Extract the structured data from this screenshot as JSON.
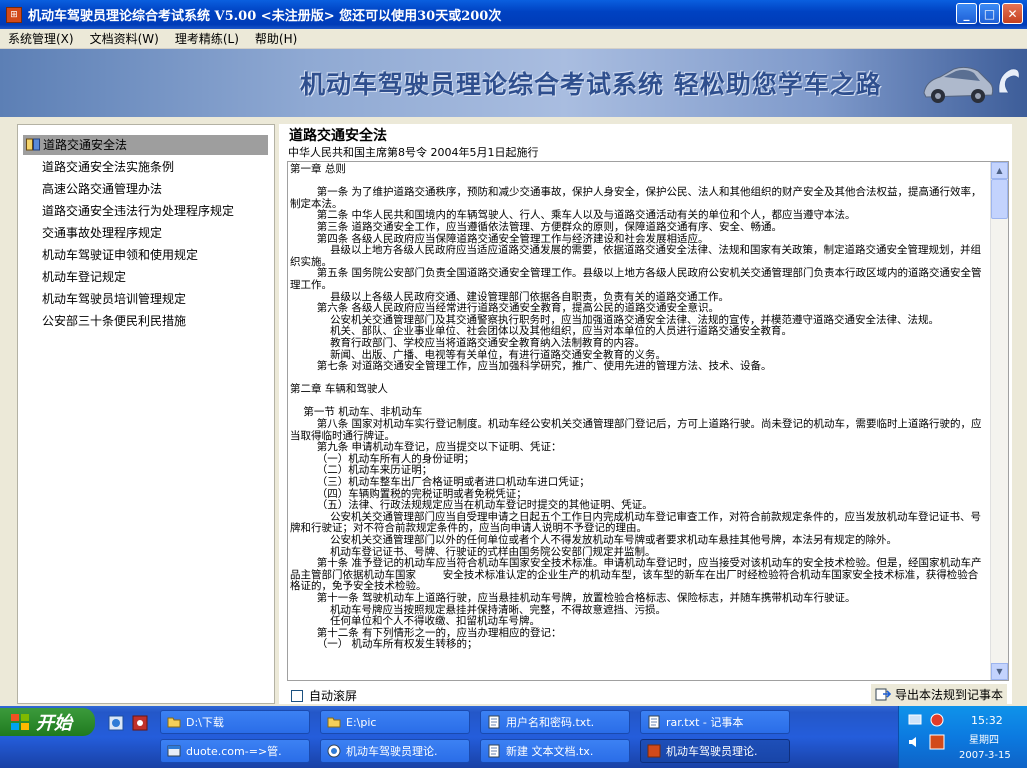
{
  "window": {
    "title": "机动车驾驶员理论综合考试系统 V5.00 <未注册版>    您还可以使用30天或200次",
    "icon_letter": "⊞",
    "min_label": "_",
    "max_label": "□",
    "close_label": "✕"
  },
  "menu": [
    "系统管理(X)",
    "文档资料(W)",
    "理考精练(L)",
    "帮助(H)"
  ],
  "banner": {
    "text": "机动车驾驶员理论综合考试系统  轻松助您学车之路"
  },
  "nav": {
    "items": [
      "道路交通安全法",
      "道路交通安全法实施条例",
      "高速公路交通管理办法",
      "道路交通安全违法行为处理程序规定",
      "交通事故处理程序规定",
      "机动车驾驶证申领和使用规定",
      "机动车登记规定",
      "机动车驾驶员培训管理规定",
      "公安部三十条便民利民措施"
    ],
    "selected_index": 0
  },
  "doc": {
    "title": "道路交通安全法",
    "subtitle": "中华人民共和国主席第8号令  2004年5月1日起施行",
    "body": "第一章 总则\n\n        第一条 为了维护道路交通秩序，预防和减少交通事故，保护人身安全，保护公民、法人和其他组织的财产安全及其他合法权益，提高通行效率，制定本法。\n        第二条 中华人民共和国境内的车辆驾驶人、行人、乘车人以及与道路交通活动有关的单位和个人，都应当遵守本法。\n        第三条 道路交通安全工作，应当遵循依法管理、方便群众的原则，保障道路交通有序、安全、畅通。\n        第四条 各级人民政府应当保障道路交通安全管理工作与经济建设和社会发展相适应。\n            县级以上地方各级人民政府应当适应道路交通发展的需要，依据道路交通安全法律、法规和国家有关政策，制定道路交通安全管理规划，并组织实施。\n        第五条 国务院公安部门负责全国道路交通安全管理工作。县级以上地方各级人民政府公安机关交通管理部门负责本行政区域内的道路交通安全管理工作。\n            县级以上各级人民政府交通、建设管理部门依据各自职责，负责有关的道路交通工作。\n        第六条 各级人民政府应当经常进行道路交通安全教育，提高公民的道路交通安全意识。\n            公安机关交通管理部门及其交通警察执行职务时，应当加强道路交通安全法律、法规的宣传，并模范遵守道路交通安全法律、法规。\n            机关、部队、企业事业单位、社会团体以及其他组织，应当对本单位的人员进行道路交通安全教育。\n            教育行政部门、学校应当将道路交通安全教育纳入法制教育的内容。\n            新闻、出版、广播、电视等有关单位，有进行道路交通安全教育的义务。\n        第七条 对道路交通安全管理工作，应当加强科学研究，推广、使用先进的管理方法、技术、设备。\n\n第二章 车辆和驾驶人\n\n    第一节 机动车、非机动车\n        第八条 国家对机动车实行登记制度。机动车经公安机关交通管理部门登记后，方可上道路行驶。尚未登记的机动车，需要临时上道路行驶的，应当取得临时通行牌证。\n        第九条 申请机动车登记，应当提交以下证明、凭证：\n        （一）机动车所有人的身份证明；\n        （二）机动车来历证明；\n        （三）机动车整车出厂合格证明或者进口机动车进口凭证；\n        （四）车辆购置税的完税证明或者免税凭证；\n        （五）法律、行政法规规定应当在机动车登记时提交的其他证明、凭证。\n            公安机关交通管理部门应当自受理申请之日起五个工作日内完成机动车登记审查工作，对符合前款规定条件的，应当发放机动车登记证书、号牌和行驶证；对不符合前款规定条件的，应当向申请人说明不予登记的理由。\n            公安机关交通管理部门以外的任何单位或者个人不得发放机动车号牌或者要求机动车悬挂其他号牌，本法另有规定的除外。\n            机动车登记证书、号牌、行驶证的式样由国务院公安部门规定并监制。\n        第十条 准予登记的机动车应当符合机动车国家安全技术标准。申请机动车登记时，应当接受对该机动车的安全技术检验。但是，经国家机动车产品主管部门依据机动车国家        安全技术标准认定的企业生产的机动车型，该车型的新车在出厂时经检验符合机动车国家安全技术标准，获得检验合格证的，免予安全技术检验。\n        第十一条 驾驶机动车上道路行驶，应当悬挂机动车号牌，放置检验合格标志、保险标志，并随车携带机动车行驶证。\n            机动车号牌应当按照规定悬挂并保持清晰、完整，不得故意遮挡、污损。\n            任何单位和个人不得收缴、扣留机动车号牌。\n        第十二条 有下列情形之一的，应当办理相应的登记：\n        （一） 机动车所有权发生转移的；"
  },
  "footer": {
    "autoscroll_label": "自动滚屏",
    "export_label": "导出本法规到记事本"
  },
  "taskbar": {
    "start_label": "开始",
    "buttons_row1": [
      "D:\\下载",
      "E:\\pic",
      "用户名和密码.txt.",
      "rar.txt - 记事本"
    ],
    "buttons_row2": [
      "duote.com-=>管.",
      "机动车驾驶员理论.",
      "新建 文本文档.tx.",
      "机动车驾驶员理论."
    ],
    "active_index_row2": 3,
    "clock_time": "15:32",
    "clock_day": "星期四",
    "clock_date": "2007-3-15"
  },
  "colors": {
    "titlebar": "#0042C2",
    "nav_selected": "#9E9E9E",
    "taskbar": "#245DDB",
    "start_green": "#2E8B2E"
  }
}
